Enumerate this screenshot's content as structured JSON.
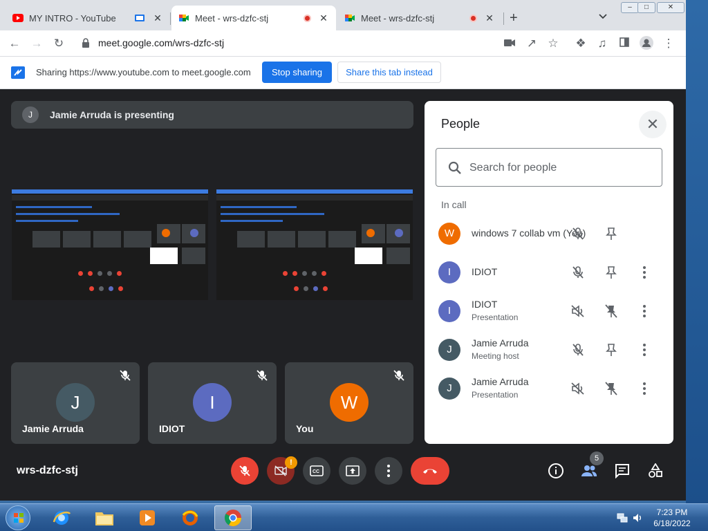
{
  "browser": {
    "tabs": [
      {
        "title": "MY INTRO - YouTube",
        "close": "✕"
      },
      {
        "title": "Meet - wrs-dzfc-stj",
        "close": "✕"
      },
      {
        "title": "Meet - wrs-dzfc-stj",
        "close": "✕"
      }
    ],
    "new_tab": "+",
    "url": "meet.google.com/wrs-dzfc-stj"
  },
  "infobar": {
    "message": "Sharing https://www.youtube.com to meet.google.com",
    "stop_label": "Stop sharing",
    "share_label": "Share this tab instead"
  },
  "meet": {
    "presenting_initial": "J",
    "presenting_text": "Jamie Arruda is presenting",
    "tiles": [
      {
        "initial": "J",
        "name": "Jamie Arruda",
        "color": "#455a64"
      },
      {
        "initial": "I",
        "name": "IDIOT",
        "color": "#5c6bc0"
      },
      {
        "initial": "W",
        "name": "You",
        "color": "#ef6c00"
      }
    ],
    "meeting_code": "wrs-dzfc-stj",
    "warning_badge": "!",
    "participant_count": "5"
  },
  "people_panel": {
    "title": "People",
    "search_placeholder": "Search for people",
    "section": "In call",
    "participants": [
      {
        "initial": "W",
        "name": "windows 7 collab vm (You)",
        "sub": "",
        "color": "#ef6c00"
      },
      {
        "initial": "I",
        "name": "IDIOT",
        "sub": "",
        "color": "#5c6bc0"
      },
      {
        "initial": "I",
        "name": "IDIOT",
        "sub": "Presentation",
        "color": "#5c6bc0"
      },
      {
        "initial": "J",
        "name": "Jamie Arruda",
        "sub": "Meeting host",
        "color": "#455a64"
      },
      {
        "initial": "J",
        "name": "Jamie Arruda",
        "sub": "Presentation",
        "color": "#455a64"
      }
    ]
  },
  "taskbar": {
    "time": "7:23 PM",
    "date": "6/18/2022"
  }
}
